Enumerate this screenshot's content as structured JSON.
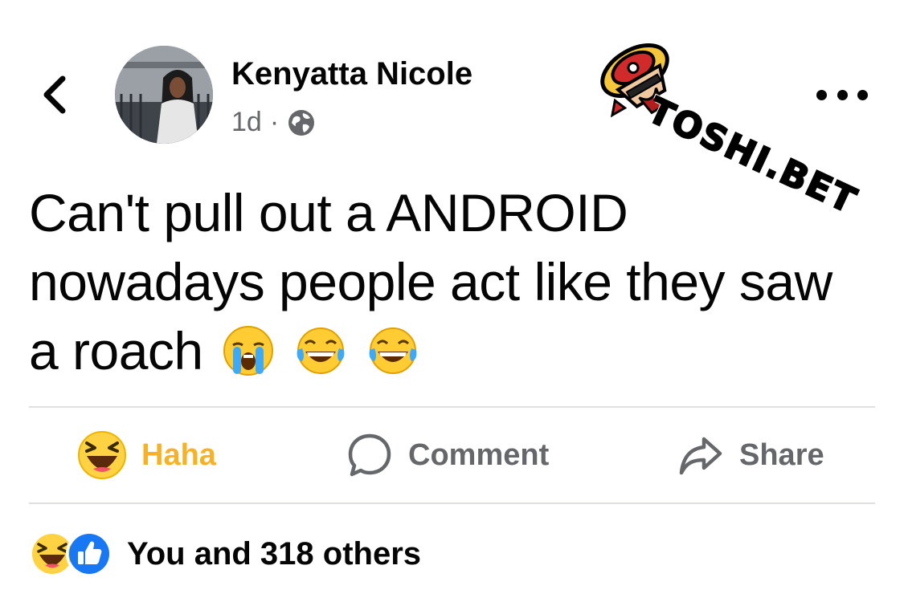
{
  "header": {
    "author_name": "Kenyatta Nicole",
    "timestamp": "1d",
    "separator": "·",
    "privacy_icon": "globe-icon",
    "back_icon": "chevron-left-icon",
    "more_icon": "more-options-icon"
  },
  "watermark": {
    "text": "TOSHI.BET"
  },
  "post": {
    "lines": [
      "Can't pull out a ANDROID",
      "nowadays people act like they saw",
      "a roach"
    ],
    "emojis": [
      "loudly-crying-face",
      "face-with-tears-of-joy",
      "face-with-tears-of-joy"
    ]
  },
  "actions": {
    "haha_label": "Haha",
    "comment_label": "Comment",
    "share_label": "Share"
  },
  "reactions": {
    "icons": [
      "haha-reaction-icon",
      "like-reaction-icon"
    ],
    "summary": "You and 318 others"
  },
  "colors": {
    "haha": "#f7b125",
    "secondary_text": "#65676b",
    "like_blue": "#1877f2",
    "divider": "#dddfe2"
  }
}
